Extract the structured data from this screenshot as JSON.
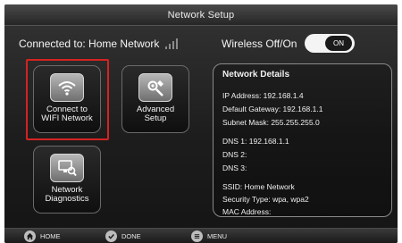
{
  "window": {
    "title": "Network Setup"
  },
  "status": {
    "connected_text": "Connected to: Home Network",
    "wireless_label": "Wireless Off/On",
    "toggle_state": "ON"
  },
  "tiles": {
    "connect": {
      "line1": "Connect to",
      "line2": "WIFI Network",
      "icon": "wifi-icon"
    },
    "advanced": {
      "line1": "Advanced",
      "line2": "Setup",
      "icon": "tools-icon"
    },
    "diagnostics": {
      "line1": "Network",
      "line2": "Diagnostics",
      "icon": "diagnostics-icon"
    }
  },
  "details": {
    "title": "Network Details",
    "ip": "IP Address: 192.168.1.4",
    "gateway": "Default Gateway: 192.168.1.1",
    "subnet": "Subnet Mask: 255.255.255.0",
    "dns1": "DNS 1: 192.168.1.1",
    "dns2": "DNS 2:",
    "dns3": "DNS 3:",
    "ssid": "SSID: Home Network",
    "security": "Security Type: wpa, wpa2",
    "mac": "MAC Address:"
  },
  "bottom": {
    "home": "HOME",
    "done": "DONE",
    "menu": "MENU"
  },
  "colors": {
    "selection": "#d52222",
    "background": "#1d1d1d"
  }
}
